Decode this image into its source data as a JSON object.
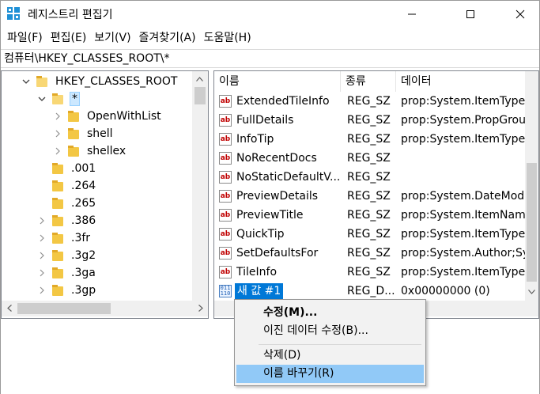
{
  "window": {
    "title": "레지스트리 편집기",
    "minimize_glyph": "─",
    "maximize_glyph": "☐",
    "close_glyph": "✕"
  },
  "menu": [
    "파일(F)",
    "편집(E)",
    "보기(V)",
    "즐겨찾기(A)",
    "도움말(H)"
  ],
  "address": "컴퓨터\\HKEY_CLASSES_ROOT\\*",
  "tree": {
    "items": [
      {
        "label": "HKEY_CLASSES_ROOT",
        "chevron": "down",
        "folder": "open"
      },
      {
        "label": "*",
        "chevron": "down",
        "folder": "open",
        "selected": true
      },
      {
        "label": "OpenWithList",
        "chevron": "right",
        "folder": "closed"
      },
      {
        "label": "shell",
        "chevron": "right",
        "folder": "closed"
      },
      {
        "label": "shellex",
        "chevron": "right",
        "folder": "closed"
      },
      {
        "label": ".001",
        "chevron": "none",
        "folder": "closed"
      },
      {
        "label": ".264",
        "chevron": "none",
        "folder": "closed"
      },
      {
        "label": ".265",
        "chevron": "none",
        "folder": "closed"
      },
      {
        "label": ".386",
        "chevron": "right",
        "folder": "closed"
      },
      {
        "label": ".3fr",
        "chevron": "right",
        "folder": "closed"
      },
      {
        "label": ".3g2",
        "chevron": "right",
        "folder": "closed"
      },
      {
        "label": ".3ga",
        "chevron": "right",
        "folder": "closed"
      },
      {
        "label": ".3gp",
        "chevron": "right",
        "folder": "closed"
      }
    ]
  },
  "list": {
    "headers": [
      "이름",
      "종류",
      "데이터"
    ],
    "rows": [
      {
        "name": "ExtendedTileInfo",
        "type": "REG_SZ",
        "data": "prop:System.ItemTypeT",
        "icon": "string-value-icon"
      },
      {
        "name": "FullDetails",
        "type": "REG_SZ",
        "data": "prop:System.PropGroup",
        "icon": "string-value-icon"
      },
      {
        "name": "InfoTip",
        "type": "REG_SZ",
        "data": "prop:System.ItemTypeT",
        "icon": "string-value-icon"
      },
      {
        "name": "NoRecentDocs",
        "type": "REG_SZ",
        "data": "",
        "icon": "string-value-icon"
      },
      {
        "name": "NoStaticDefaultV...",
        "type": "REG_SZ",
        "data": "",
        "icon": "string-value-icon"
      },
      {
        "name": "PreviewDetails",
        "type": "REG_SZ",
        "data": "prop:System.DateModifi",
        "icon": "string-value-icon"
      },
      {
        "name": "PreviewTitle",
        "type": "REG_SZ",
        "data": "prop:System.ItemName",
        "icon": "string-value-icon"
      },
      {
        "name": "QuickTip",
        "type": "REG_SZ",
        "data": "prop:System.ItemTypeT",
        "icon": "string-value-icon"
      },
      {
        "name": "SetDefaultsFor",
        "type": "REG_SZ",
        "data": "prop:System.Author;Sys",
        "icon": "string-value-icon"
      },
      {
        "name": "TileInfo",
        "type": "REG_SZ",
        "data": "prop:System.ItemTypeT",
        "icon": "string-value-icon"
      },
      {
        "name": "새 값 #1",
        "type": "REG_D...",
        "data": "0x00000000 (0)",
        "icon": "binary-value-icon",
        "editing": true
      }
    ],
    "ab_glyph": "ab",
    "bin_glyph": "011\n110"
  },
  "context_menu": {
    "items": [
      {
        "label": "수정(M)...",
        "bold": true
      },
      {
        "label": "이진 데이터 수정(B)..."
      },
      {
        "separator": true
      },
      {
        "label": "삭제(D)"
      },
      {
        "label": "이름 바꾸기(R)",
        "highlighted": true
      }
    ]
  },
  "colors": {
    "selection": "#0078d7",
    "menu_highlight": "#91c9f7",
    "folder": "#f3c744"
  }
}
